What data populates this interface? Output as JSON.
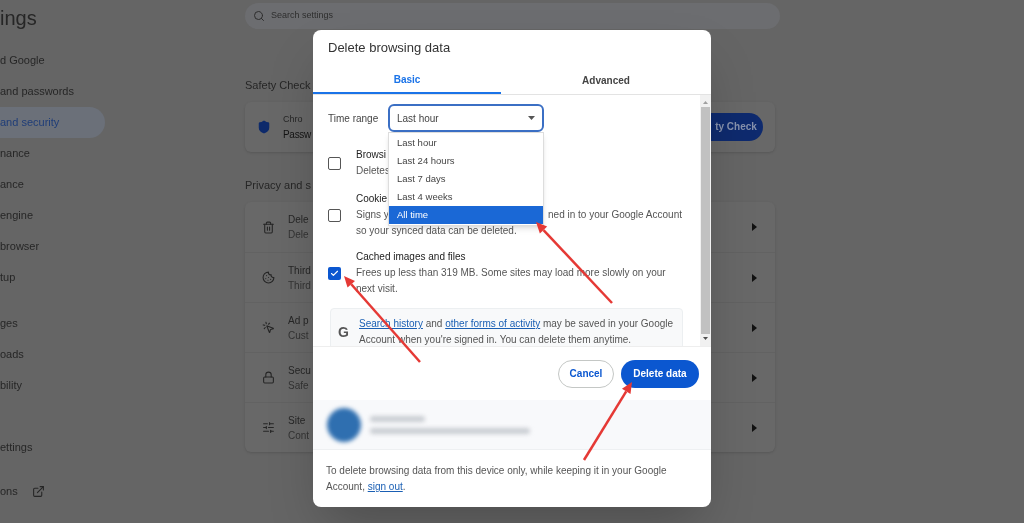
{
  "page_title": "ings",
  "sidebar": {
    "groups": [
      [
        {
          "label": "d Google",
          "selected": false
        },
        {
          "label": "and passwords",
          "selected": false
        },
        {
          "label": "and security",
          "selected": true
        },
        {
          "label": "nance",
          "selected": false
        },
        {
          "label": "ance",
          "selected": false
        },
        {
          "label": "engine",
          "selected": false
        },
        {
          "label": "browser",
          "selected": false
        },
        {
          "label": "tup",
          "selected": false
        }
      ],
      [
        {
          "label": "ges",
          "selected": false
        },
        {
          "label": "oads",
          "selected": false
        },
        {
          "label": "bility",
          "selected": false
        }
      ],
      [
        {
          "label": "ettings",
          "selected": false
        }
      ]
    ],
    "external_link": {
      "label": "ons"
    }
  },
  "search": {
    "placeholder": "Search settings"
  },
  "safety_check": {
    "heading": "Safety Check",
    "title": "Chro",
    "subtitle": "Passw",
    "button": "ty Check"
  },
  "privacy": {
    "heading": "Privacy and s",
    "rows": [
      {
        "title": "Dele",
        "subtitle": "Dele"
      },
      {
        "title": "Third",
        "subtitle": "Third"
      },
      {
        "title": "Ad p",
        "subtitle": "Cust"
      },
      {
        "title": "Secu",
        "subtitle": "Safe"
      },
      {
        "title": "Site",
        "subtitle": "Cont"
      }
    ]
  },
  "dialog": {
    "title": "Delete browsing data",
    "tabs": [
      {
        "label": "Basic",
        "selected": true
      },
      {
        "label": "Advanced",
        "selected": false
      }
    ],
    "time_range": {
      "label": "Time range",
      "value": "Last hour"
    },
    "dropdown": {
      "options": [
        {
          "label": "Last hour",
          "selected": false
        },
        {
          "label": "Last 24 hours",
          "selected": false
        },
        {
          "label": "Last 7 days",
          "selected": false
        },
        {
          "label": "Last 4 weeks",
          "selected": false
        },
        {
          "label": "All time",
          "selected": true
        }
      ]
    },
    "items": [
      {
        "title": "Browsi",
        "checked": false,
        "lines": [
          {
            "text": "Deletes"
          }
        ]
      },
      {
        "title": "Cookie",
        "checked": false,
        "lines": [
          {
            "text": "Signs y",
            "after_gap": "ned in to your Google Account"
          },
          {
            "text": "so your synced data can be deleted."
          }
        ]
      },
      {
        "title": "Cached images and files",
        "checked": true,
        "lines": [
          {
            "text": "Frees up less than 319 MB. Some sites may load more slowly on your"
          },
          {
            "text": "next visit."
          }
        ]
      }
    ],
    "info": {
      "icon_letter": "G",
      "link_1": "Search history",
      "text_1": " and ",
      "link_2": "other forms of activity",
      "text_2": " may be saved in your Google Account when you're signed in. You can delete them anytime."
    },
    "cancel": "Cancel",
    "confirm": "Delete data",
    "note": {
      "text": "To delete browsing data from this device only, while keeping it in your Google Account, ",
      "link": "sign out",
      "end": "."
    }
  }
}
